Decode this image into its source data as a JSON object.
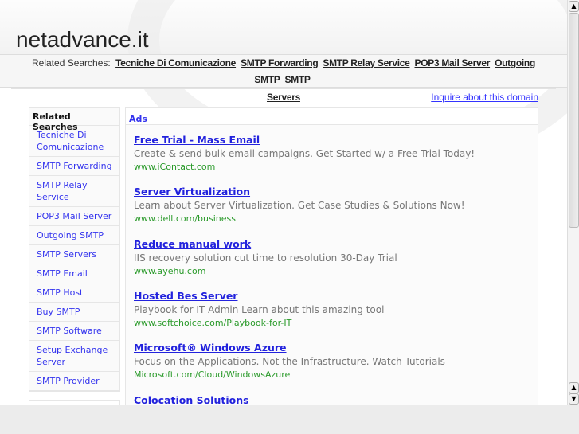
{
  "site_title": "netadvance.it",
  "related_bar": {
    "label": "Related Searches:",
    "links": [
      "Tecniche Di Comunicazione",
      "SMTP Forwarding",
      "SMTP Relay Service",
      "POP3 Mail Server",
      "Outgoing SMTP",
      "SMTP",
      "Servers"
    ]
  },
  "inquire": "Inquire about this domain",
  "sidebar": {
    "heading": "Related Searches",
    "items": [
      "Tecniche Di Comunicazione",
      "SMTP Forwarding",
      "SMTP Relay Service",
      "POP3 Mail Server",
      "Outgoing SMTP",
      "SMTP Servers",
      "SMTP Email",
      "SMTP Host",
      "Buy SMTP",
      "SMTP Software",
      "Setup Exchange Server",
      "SMTP Provider"
    ]
  },
  "ads": {
    "heading": "Ads",
    "items": [
      {
        "title": "Free Trial - Mass Email",
        "desc": "Create & send bulk email campaigns. Get Started w/ a Free Trial Today!",
        "url": "www.iContact.com"
      },
      {
        "title": "Server Virtualization",
        "desc": "Learn about Server Virtualization. Get Case Studies & Solutions Now!",
        "url": "www.dell.com/business"
      },
      {
        "title": "Reduce manual work",
        "desc": "IIS recovery solution cut time to resolution 30-Day Trial",
        "url": "www.ayehu.com"
      },
      {
        "title": "Hosted Bes Server",
        "desc": "Playbook for IT Admin Learn about this amazing tool",
        "url": "www.softchoice.com/Playbook-for-IT"
      },
      {
        "title": "Microsoft® Windows Azure",
        "desc": "Focus on the Applications. Not the Infrastructure. Watch Tutorials",
        "url": "Microsoft.com/Cloud/WindowsAzure"
      },
      {
        "title": "Colocation Solutions",
        "desc": "",
        "url": ""
      }
    ]
  }
}
